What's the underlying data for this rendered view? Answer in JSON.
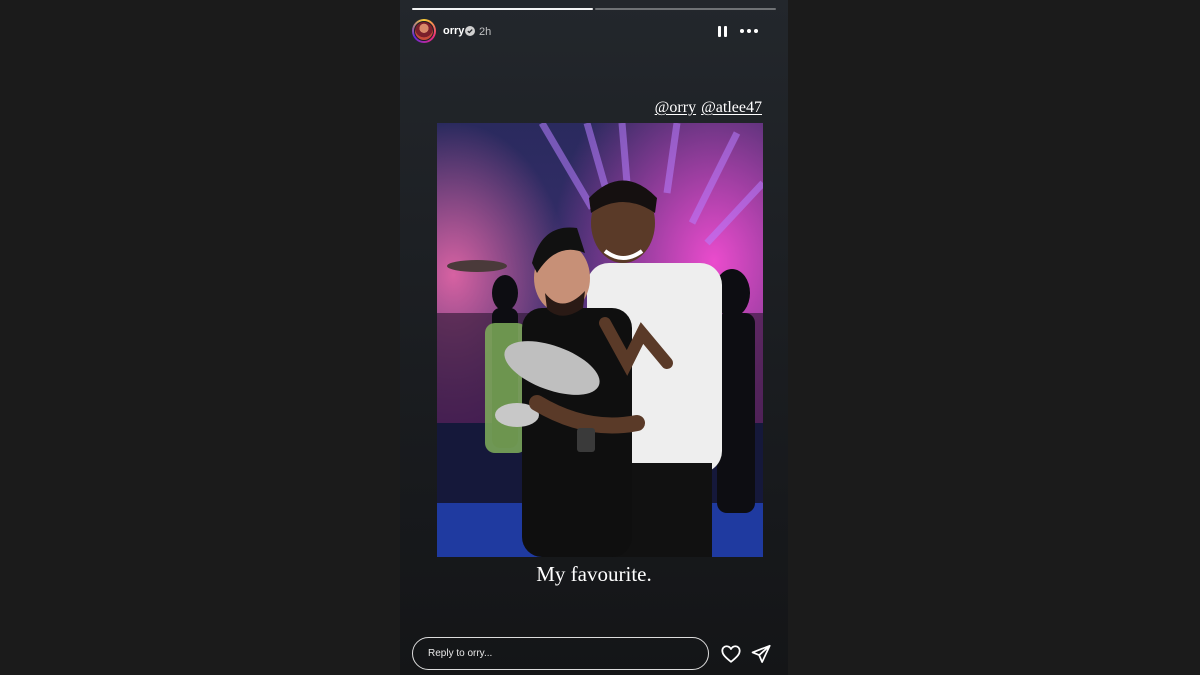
{
  "story": {
    "username": "orry",
    "time": "2h",
    "mentions": [
      "@orry",
      "@atlee47"
    ],
    "caption": "My favourite.",
    "progress_segments": 2,
    "active_segment": 1
  },
  "reply": {
    "placeholder": "Reply to orry..."
  },
  "icons": {
    "verified": "verified-badge-icon",
    "pause": "pause-icon",
    "more": "more-options-icon",
    "like": "heart-icon",
    "send": "send-icon"
  },
  "colors": {
    "background": "#1b1b1b",
    "story_bg": "#1d2024",
    "verified": "#3897f0"
  }
}
